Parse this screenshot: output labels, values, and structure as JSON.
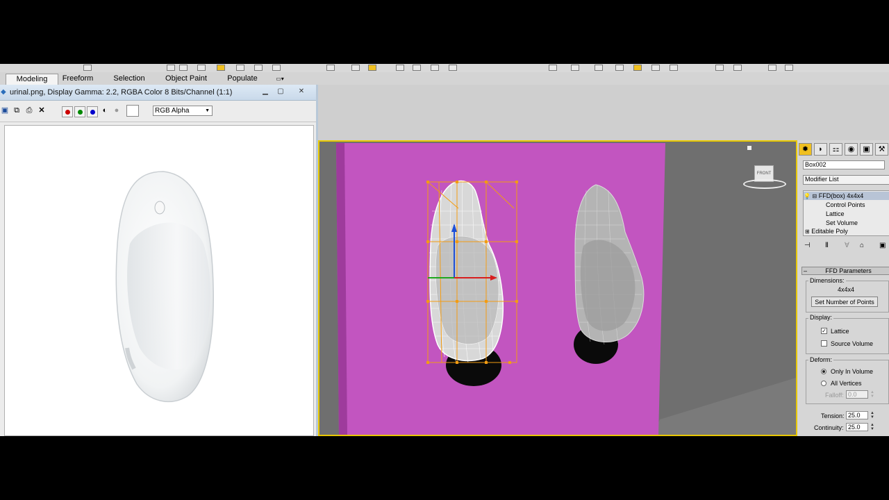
{
  "ribbon": {
    "tabs": [
      {
        "label": "Modeling",
        "active": true
      },
      {
        "label": "Freeform",
        "active": false
      },
      {
        "label": "Selection",
        "active": false
      },
      {
        "label": "Object Paint",
        "active": false
      },
      {
        "label": "Populate",
        "active": false
      }
    ]
  },
  "viewer": {
    "title": "urinal.png, Display Gamma: 2.2, RGBA Color 8 Bits/Channel (1:1)",
    "channel_select": "RGB Alpha",
    "channel_colors": {
      "red": "#cc0000",
      "green": "#008800",
      "blue": "#0000cc"
    }
  },
  "viewport": {
    "background": "#6f6f6f",
    "wall_color": "#c255c0",
    "viewcube_label": "FRONT",
    "selection_color": "#f39c12"
  },
  "command_panel": {
    "object_name": "Box002",
    "modifier_list": "Modifier List",
    "stack": [
      {
        "label": "FFD(box) 4x4x4",
        "level": 0,
        "selected": true
      },
      {
        "label": "Control Points",
        "level": 1
      },
      {
        "label": "Lattice",
        "level": 1
      },
      {
        "label": "Set Volume",
        "level": 1
      },
      {
        "label": "Editable Poly",
        "level": 0
      }
    ],
    "ffd": {
      "rollout_title": "FFD Parameters",
      "dimensions_label": "Dimensions:",
      "dimensions_value": "4x4x4",
      "set_points_button": "Set Number of Points",
      "display_label": "Display:",
      "lattice_label": "Lattice",
      "lattice_checked": true,
      "source_volume_label": "Source Volume",
      "source_volume_checked": false,
      "deform_label": "Deform:",
      "only_in_volume_label": "Only In Volume",
      "all_vertices_label": "All Vertices",
      "falloff_label": "Falloff:",
      "falloff_value": "0.0",
      "tension_label": "Tension:",
      "tension_value": "25.0",
      "continuity_label": "Continuity:",
      "continuity_value": "25.0"
    }
  }
}
